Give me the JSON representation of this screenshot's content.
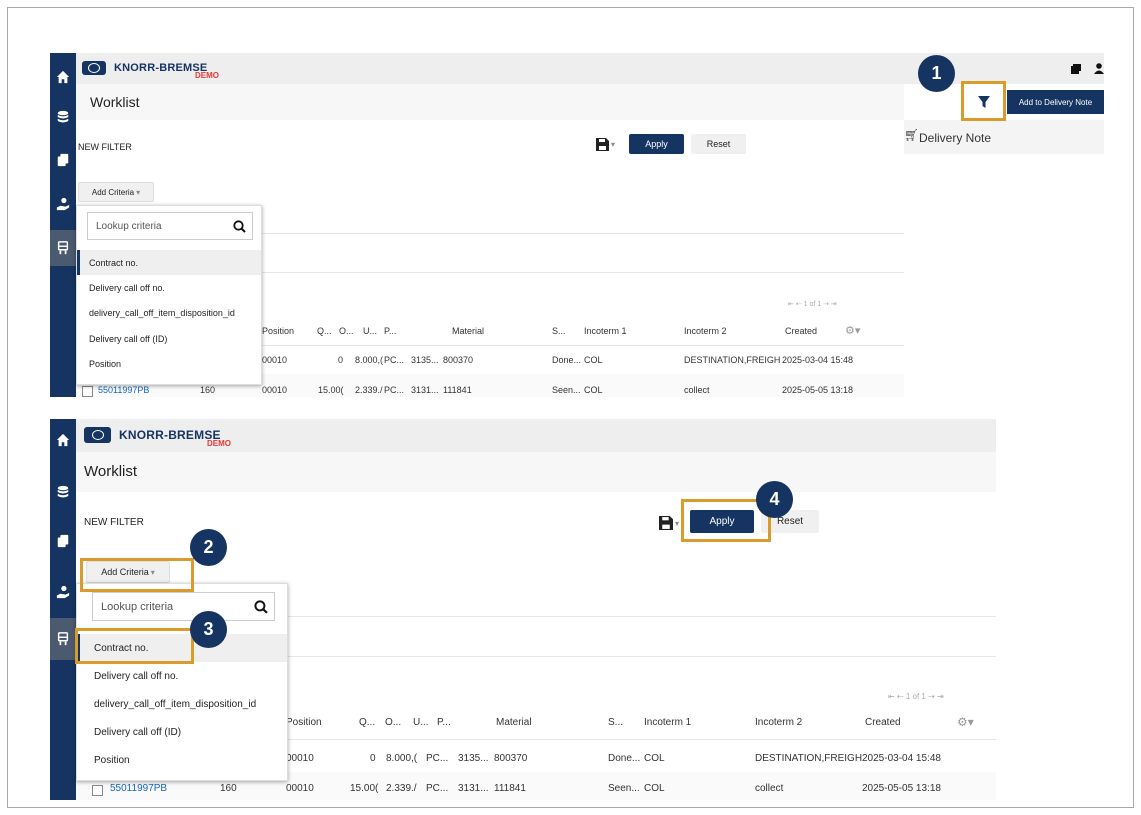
{
  "brand": {
    "name": "KNORR-BREMSE",
    "demo": "DEMO"
  },
  "page_title": "Worklist",
  "filter": {
    "new_filter": "NEW FILTER",
    "apply": "Apply",
    "reset": "Reset",
    "add_criteria": "Add Criteria",
    "lookup_placeholder": "Lookup criteria",
    "criteria": [
      "Contract no.",
      "Delivery call off no.",
      "delivery_call_off_item_disposition_id",
      "Delivery call off (ID)",
      "Position"
    ]
  },
  "right_panel": {
    "add_to_delivery_note": "Add to Delivery Note",
    "delivery_note": "Delivery Note"
  },
  "table": {
    "pager": "⇤ ⇠ 1 of 1 ⇢ ⇥",
    "headers": [
      "Position",
      "Q...",
      "O...",
      "U...",
      "P...",
      "Material",
      "S...",
      "Incoterm 1",
      "Incoterm 2",
      "Created"
    ],
    "rows": [
      {
        "contract": "",
        "num": "",
        "position": "00010",
        "qty": "0",
        "o": "8.000,(",
        "u": "PC...",
        "p": "3135...",
        "material": "800370",
        "s": "Done...",
        "inc1": "COL",
        "inc2": "DESTINATION,FREIGH",
        "created": "2025-03-04 15:48"
      },
      {
        "contract": "55011997PB",
        "num": "160",
        "position": "00010",
        "qty": "15.00(",
        "o": "2.339./",
        "u": "PC...",
        "p": "3131...",
        "material": "111841",
        "s": "Seen...",
        "inc1": "COL",
        "inc2": "collect",
        "created": "2025-05-05 13:18"
      }
    ]
  },
  "callouts": [
    "1",
    "2",
    "3",
    "4"
  ],
  "colors": {
    "navy": "#153461",
    "highlight": "#d99b2b",
    "link": "#1565c0",
    "demo_red": "#e53935"
  }
}
